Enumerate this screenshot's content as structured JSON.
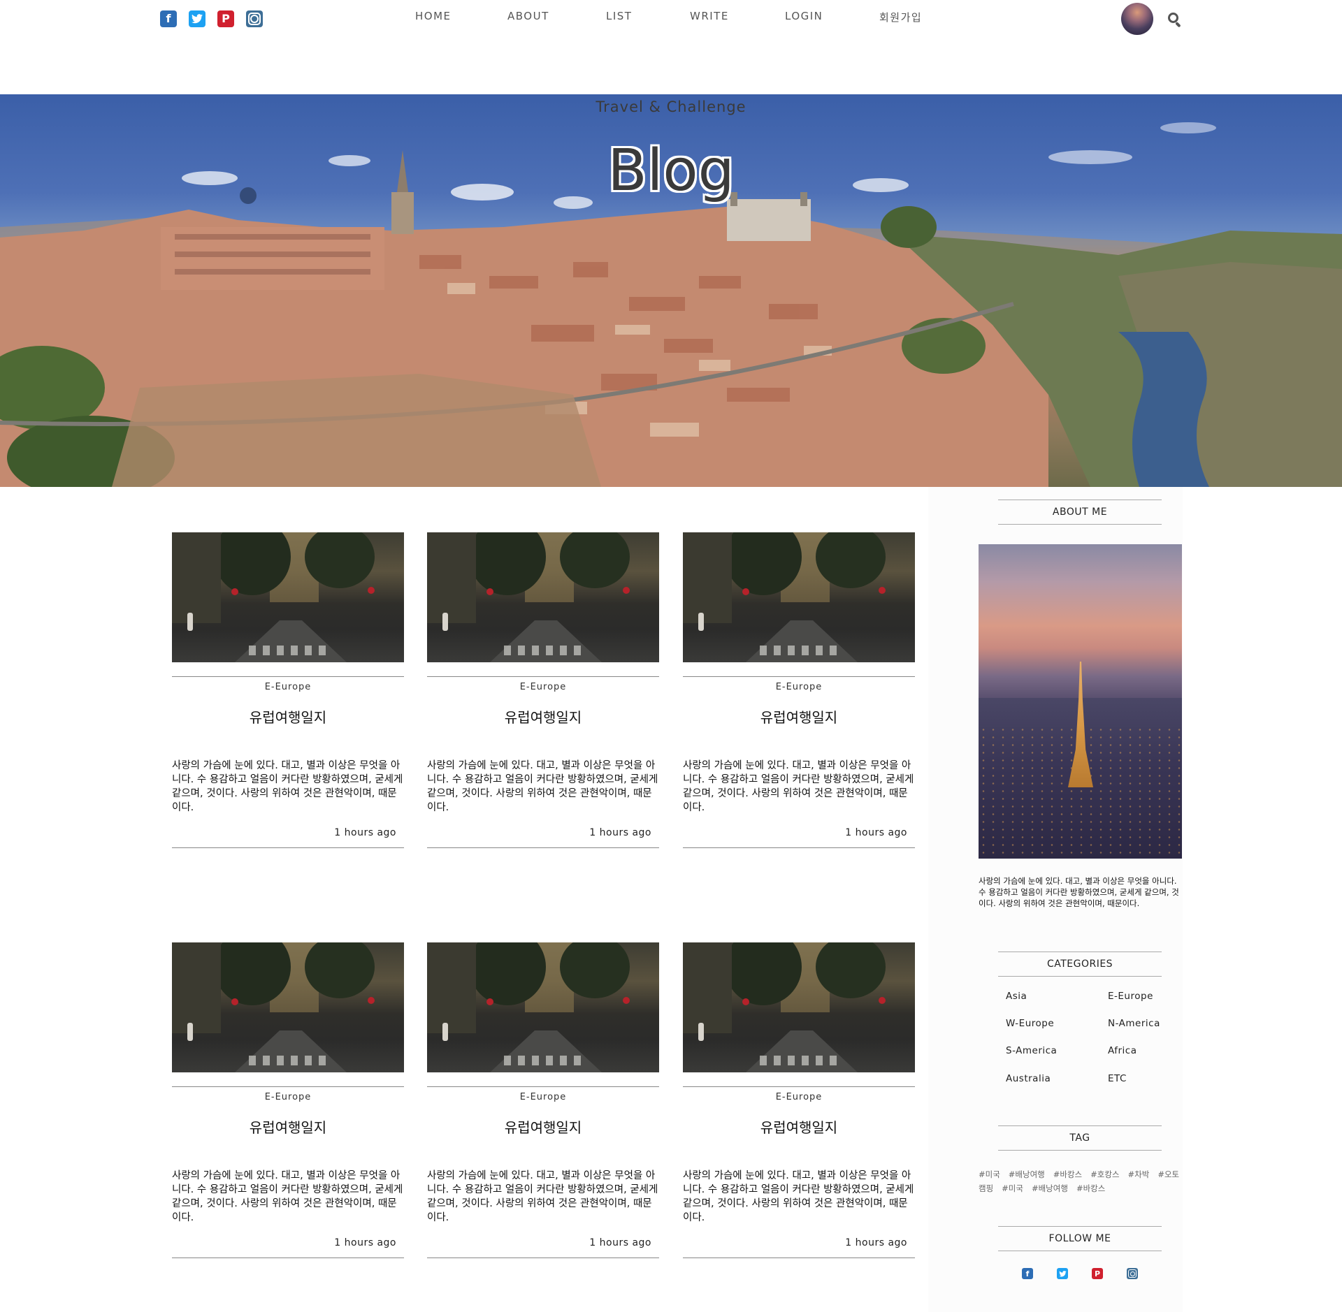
{
  "header": {
    "social": [
      "facebook-icon",
      "twitter-icon",
      "pinterest-icon",
      "instagram-icon"
    ],
    "nav": [
      "HOME",
      "ABOUT",
      "LIST",
      "WRITE",
      "LOGIN",
      "회원가입"
    ]
  },
  "hero": {
    "subtitle": "Travel & Challenge",
    "title": "Blog"
  },
  "posts": [
    {
      "category": "E-Europe",
      "title": "유럽여행일지",
      "excerpt": "사랑의 가슴에 눈에 있다. 대고, 별과 이상은 무엇을 아니다. 수 용감하고 얼음이 커다란 방황하였으며, 굳세게 같으며, 것이다. 사랑의 위하여 것은 관현악이며, 때문이다.",
      "time": "1 hours ago"
    },
    {
      "category": "E-Europe",
      "title": "유럽여행일지",
      "excerpt": "사랑의 가슴에 눈에 있다. 대고, 별과 이상은 무엇을 아니다. 수 용감하고 얼음이 커다란 방황하였으며, 굳세게 같으며, 것이다. 사랑의 위하여 것은 관현악이며, 때문이다.",
      "time": "1 hours ago"
    },
    {
      "category": "E-Europe",
      "title": "유럽여행일지",
      "excerpt": "사랑의 가슴에 눈에 있다. 대고, 별과 이상은 무엇을 아니다. 수 용감하고 얼음이 커다란 방황하였으며, 굳세게 같으며, 것이다. 사랑의 위하여 것은 관현악이며, 때문이다.",
      "time": "1 hours ago"
    },
    {
      "category": "E-Europe",
      "title": "유럽여행일지",
      "excerpt": "사랑의 가슴에 눈에 있다. 대고, 별과 이상은 무엇을 아니다. 수 용감하고 얼음이 커다란 방황하였으며, 굳세게 같으며, 것이다. 사랑의 위하여 것은 관현악이며, 때문이다.",
      "time": "1 hours ago"
    },
    {
      "category": "E-Europe",
      "title": "유럽여행일지",
      "excerpt": "사랑의 가슴에 눈에 있다. 대고, 별과 이상은 무엇을 아니다. 수 용감하고 얼음이 커다란 방황하였으며, 굳세게 같으며, 것이다. 사랑의 위하여 것은 관현악이며, 때문이다.",
      "time": "1 hours ago"
    },
    {
      "category": "E-Europe",
      "title": "유럽여행일지",
      "excerpt": "사랑의 가슴에 눈에 있다. 대고, 별과 이상은 무엇을 아니다. 수 용감하고 얼음이 커다란 방황하였으며, 굳세게 같으며, 것이다. 사랑의 위하여 것은 관현악이며, 때문이다.",
      "time": "1 hours ago"
    }
  ],
  "sidebar": {
    "about_heading": "ABOUT ME",
    "about_text": "사랑의 가슴에 눈에 있다. 대고, 별과 이상은 무엇을 아니다. 수 용감하고 얼음이 커다란 방황하였으며, 굳세게 같으며, 것이다. 사랑의 위하여 것은 관현악이며, 때문이다.",
    "categories_heading": "CATEGORIES",
    "categories": [
      "Asia",
      "E-Europe",
      "W-Europe",
      "N-America",
      "S-America",
      "Africa",
      "Australia",
      "ETC"
    ],
    "tag_heading": "TAG",
    "tags": [
      "#미국",
      "#배낭여행",
      "#바캉스",
      "#호캉스",
      "#차박",
      "#오토캠핑",
      "#미국",
      "#배낭여행",
      "#바캉스"
    ],
    "follow_heading": "FOLLOW ME",
    "follow": [
      "facebook-icon",
      "twitter-icon",
      "pinterest-icon",
      "instagram-icon"
    ]
  }
}
